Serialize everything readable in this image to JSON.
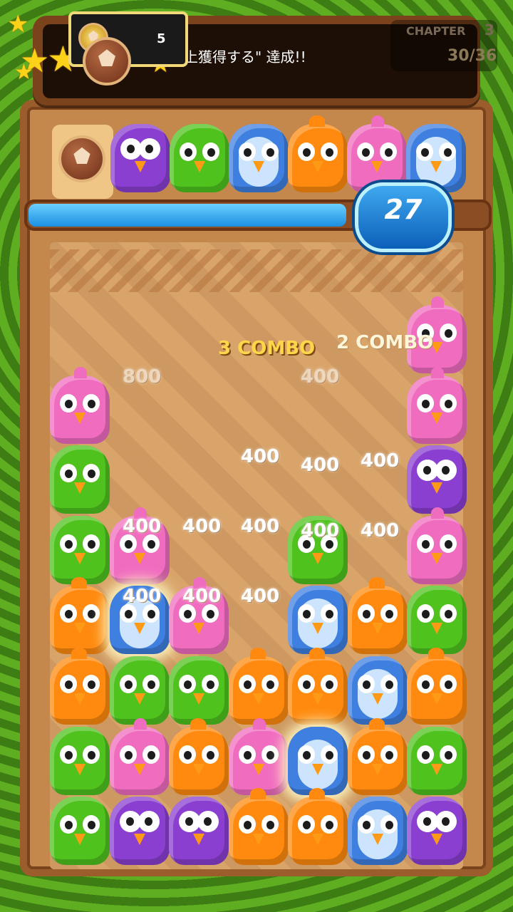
{
  "header": {
    "mission_text": "上獲得する\" 達成!!",
    "chapter_label": "CHAPTER",
    "chapter_number": "3",
    "progress": "30/36",
    "coin_count": "5"
  },
  "timer": {
    "value": "27",
    "fill_fraction": 0.72
  },
  "target_row": [
    "badge",
    "purple",
    "green",
    "blue",
    "orange",
    "pink",
    "blue"
  ],
  "combos": [
    {
      "text": "3 COMBO"
    },
    {
      "text": "2 COMBO"
    }
  ],
  "scores": [
    "800",
    "400",
    "400",
    "400",
    "400",
    "400",
    "400",
    "400",
    "400",
    "400",
    "400",
    "400",
    "400"
  ],
  "board": {
    "columns": 7,
    "rows": [
      [
        "",
        "",
        "",
        "",
        "",
        "",
        "pink"
      ],
      [
        "pink",
        "",
        "",
        "",
        "",
        "",
        "pink"
      ],
      [
        "green",
        "",
        "",
        "",
        "",
        "",
        "purple"
      ],
      [
        "green",
        "pink",
        "",
        "",
        "green",
        "",
        "pink"
      ],
      [
        "orange",
        "blue",
        "pink",
        "",
        "blue",
        "orange",
        "green"
      ],
      [
        "orange",
        "green",
        "green",
        "orange",
        "orange",
        "blue",
        "orange"
      ],
      [
        "green",
        "pink",
        "orange",
        "pink",
        "blue",
        "orange",
        "green"
      ],
      [
        "green",
        "purple",
        "purple",
        "orange",
        "orange",
        "blue",
        "purple"
      ]
    ],
    "glowing": [
      [
        4,
        1
      ],
      [
        6,
        4
      ]
    ]
  },
  "colors": {
    "board_wood": "#c4884d",
    "timer_blue": "#1b8fe0",
    "combo_yellow": "#ffd54a",
    "leaf_green": "#4e8a1f"
  }
}
